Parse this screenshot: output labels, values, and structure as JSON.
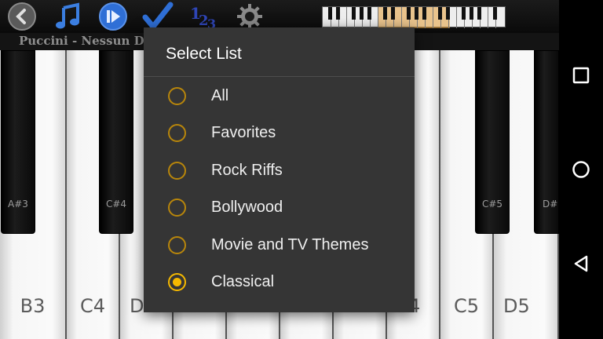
{
  "toolbar": {
    "song_title": "Puccini - Nessun Do",
    "icons": [
      "back-icon",
      "music-note-icon",
      "play-icon",
      "checkmark-icon",
      "numbers-icon",
      "gear-icon"
    ]
  },
  "piano": {
    "white_keys": [
      "B3",
      "C4",
      "D",
      "",
      "",
      "",
      "",
      "4",
      "C5",
      "D5"
    ],
    "black_keys": [
      "A#3",
      "C#4",
      "C#5",
      "D#"
    ]
  },
  "dialog": {
    "title": "Select List",
    "options": [
      {
        "label": "All",
        "selected": false
      },
      {
        "label": "Favorites",
        "selected": false
      },
      {
        "label": "Rock Riffs",
        "selected": false
      },
      {
        "label": "Bollywood",
        "selected": false
      },
      {
        "label": "Movie and TV Themes",
        "selected": false
      },
      {
        "label": "Classical",
        "selected": true
      }
    ]
  },
  "colors": {
    "accent": "#f5b800",
    "dialog_bg": "#353535",
    "toolbar_icon_blue": "#2f6fd6"
  }
}
